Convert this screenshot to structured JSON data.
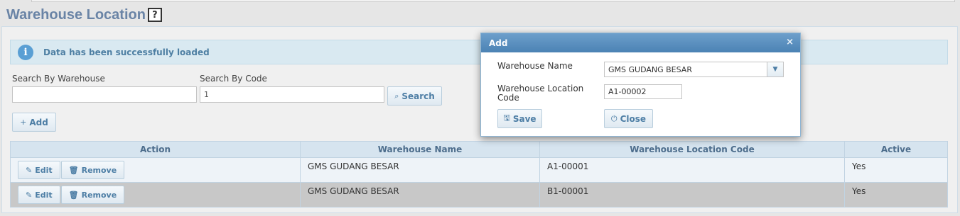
{
  "page": {
    "title": "Warehouse Location",
    "help_icon": "?"
  },
  "alert": {
    "icon": "info-icon",
    "message": "Data has been successfully loaded"
  },
  "search": {
    "warehouse_label": "Search By Warehouse",
    "warehouse_value": "",
    "code_label": "Search By Code",
    "code_value": "1",
    "search_button": "Search",
    "search_icon": "search-icon"
  },
  "toolbar": {
    "add_button": "Add",
    "add_icon_glyph": "+"
  },
  "grid": {
    "columns": [
      "Action",
      "Warehouse Name",
      "Warehouse Location Code",
      "Active"
    ],
    "edit_label": "Edit",
    "remove_label": "Remove",
    "rows": [
      {
        "warehouse_name": "GMS GUDANG BESAR",
        "location_code": "A1-00001",
        "active": "Yes",
        "selected": false
      },
      {
        "warehouse_name": "GMS GUDANG BESAR",
        "location_code": "B1-00001",
        "active": "Yes",
        "selected": true
      }
    ]
  },
  "dialog": {
    "title": "Add",
    "close_glyph": "×",
    "warehouse_name_label": "Warehouse Name",
    "warehouse_name_value": "GMS GUDANG BESAR",
    "location_code_label_line1": "Warehouse Location",
    "location_code_label_line2": "Code",
    "location_code_value": "A1-00002",
    "save_button": "Save",
    "close_button": "Close"
  },
  "colors": {
    "title": "#6a84a6",
    "accent": "#4d7ea5",
    "dialog_header": "#5b8fc0",
    "selected_row": "#c8c8c8"
  }
}
